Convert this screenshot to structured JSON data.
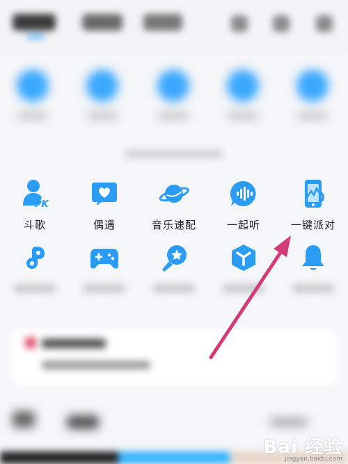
{
  "grid": {
    "row1": [
      {
        "label": "斗歌",
        "icon": "pk-user-icon"
      },
      {
        "label": "偶遇",
        "icon": "heart-chat-icon"
      },
      {
        "label": "音乐速配",
        "icon": "planet-icon"
      },
      {
        "label": "一起听",
        "icon": "sound-wave-chat-icon"
      },
      {
        "label": "一键派对",
        "icon": "party-phone-icon"
      }
    ],
    "row2": [
      {
        "icon": "music-note-icon"
      },
      {
        "icon": "gamepad-icon"
      },
      {
        "icon": "microphone-star-icon"
      },
      {
        "icon": "cube-icon"
      },
      {
        "icon": "bell-icon"
      }
    ]
  },
  "watermark": {
    "main": "Bai 经验",
    "sub": "jingyan.baidu.com"
  },
  "colors": {
    "accent": "#2a9cf4",
    "arrow": "#d23a7a",
    "background": "#f5f6f8"
  }
}
